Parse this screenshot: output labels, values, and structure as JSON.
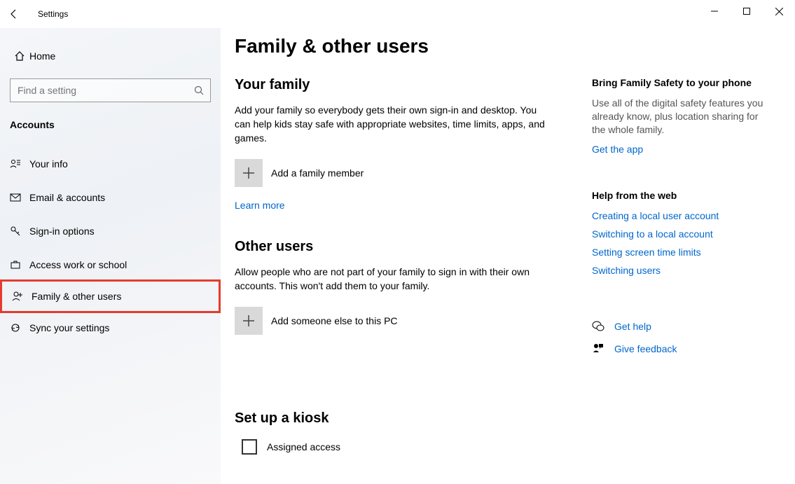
{
  "window": {
    "title": "Settings"
  },
  "sidebar": {
    "home": "Home",
    "search_placeholder": "Find a setting",
    "category": "Accounts",
    "items": [
      {
        "label": "Your info"
      },
      {
        "label": "Email & accounts"
      },
      {
        "label": "Sign-in options"
      },
      {
        "label": "Access work or school"
      },
      {
        "label": "Family & other users"
      },
      {
        "label": "Sync your settings"
      }
    ]
  },
  "main": {
    "title": "Family & other users",
    "family": {
      "heading": "Your family",
      "desc": "Add your family so everybody gets their own sign-in and desktop. You can help kids stay safe with appropriate websites, time limits, apps, and games.",
      "add_label": "Add a family member",
      "learn_more": "Learn more"
    },
    "others": {
      "heading": "Other users",
      "desc": "Allow people who are not part of your family to sign in with their own accounts. This won't add them to your family.",
      "add_label": "Add someone else to this PC"
    },
    "kiosk": {
      "heading": "Set up a kiosk",
      "assigned": "Assigned access"
    }
  },
  "right": {
    "family_safety": {
      "heading": "Bring Family Safety to your phone",
      "desc": "Use all of the digital safety features you already know, plus location sharing for the whole family.",
      "link": "Get the app"
    },
    "help": {
      "heading": "Help from the web",
      "links": [
        "Creating a local user account",
        "Switching to a local account",
        "Setting screen time limits",
        "Switching users"
      ]
    },
    "get_help": "Get help",
    "feedback": "Give feedback"
  }
}
